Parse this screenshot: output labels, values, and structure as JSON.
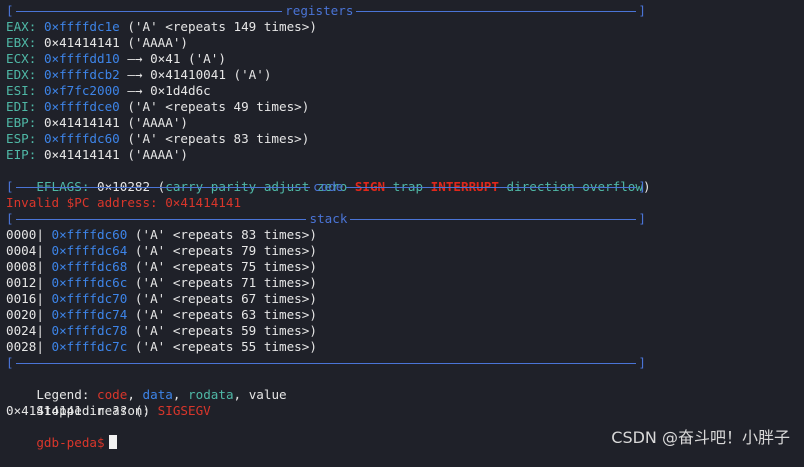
{
  "sections": {
    "registers": "registers",
    "code": "code",
    "stack": "stack"
  },
  "registers": [
    {
      "name": "EAX:",
      "addr": "0×ffffdc1e",
      "rest": " ('A' <repeats 149 times>)"
    },
    {
      "name": "EBX:",
      "addr": "0×41414141",
      "rest": " ('AAAA')",
      "plain": true
    },
    {
      "name": "ECX:",
      "addr": "0×ffffdd10",
      "rest": " —→ 0×41 ('A')"
    },
    {
      "name": "EDX:",
      "addr": "0×ffffdcb2",
      "rest": " —→ 0×41410041 ('A')"
    },
    {
      "name": "ESI:",
      "addr": "0×f7fc2000",
      "rest": " —→ 0×1d4d6c"
    },
    {
      "name": "EDI:",
      "addr": "0×ffffdce0",
      "rest": " ('A' <repeats 49 times>)"
    },
    {
      "name": "EBP:",
      "addr": "0×41414141",
      "rest": " ('AAAA')",
      "plain": true
    },
    {
      "name": "ESP:",
      "addr": "0×ffffdc60",
      "rest": " ('A' <repeats 83 times>)"
    },
    {
      "name": "EIP:",
      "addr": "0×41414141",
      "rest": " ('AAAA')",
      "plain": true
    }
  ],
  "eflags": {
    "label": "EFLAGS:",
    "value": " 0×10282 (",
    "f1": "carry parity adjust zero ",
    "sign": "SIGN",
    "f2": " trap ",
    "interrupt": "INTERRUPT",
    "f3": " direction overflow",
    "close": ")"
  },
  "code_msg": "Invalid $PC address: 0×41414141",
  "stack": [
    {
      "off": "0000|",
      "addr": "0×ffffdc60",
      "rest": " ('A' <repeats 83 times>)"
    },
    {
      "off": "0004|",
      "addr": "0×ffffdc64",
      "rest": " ('A' <repeats 79 times>)"
    },
    {
      "off": "0008|",
      "addr": "0×ffffdc68",
      "rest": " ('A' <repeats 75 times>)"
    },
    {
      "off": "0012|",
      "addr": "0×ffffdc6c",
      "rest": " ('A' <repeats 71 times>)"
    },
    {
      "off": "0016|",
      "addr": "0×ffffdc70",
      "rest": " ('A' <repeats 67 times>)"
    },
    {
      "off": "0020|",
      "addr": "0×ffffdc74",
      "rest": " ('A' <repeats 63 times>)"
    },
    {
      "off": "0024|",
      "addr": "0×ffffdc78",
      "rest": " ('A' <repeats 59 times>)"
    },
    {
      "off": "0028|",
      "addr": "0×ffffdc7c",
      "rest": " ('A' <repeats 55 times>)"
    }
  ],
  "legend": {
    "label": "Legend: ",
    "code": "code",
    "c1": ", ",
    "data": "data",
    "c2": ", ",
    "rodata": "rodata",
    "c3": ", ",
    "value": "value"
  },
  "stopped": {
    "label": "Stopped reason: ",
    "reason": "SIGSEGV"
  },
  "frame": "0×41414141 in ?? ()",
  "prompt": "gdb-peda$",
  "watermark": "CSDN @奋斗吧！小胖子",
  "colors": {
    "separator": "#4a74d6",
    "register": "#4fb8a6",
    "address": "#3d84e8",
    "alert": "#e0271b"
  }
}
